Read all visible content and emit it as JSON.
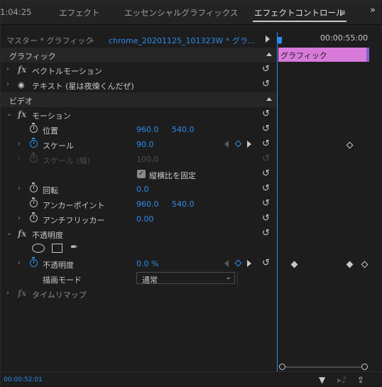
{
  "tabs": {
    "timecode": "1:04:25",
    "effects": "エフェクト",
    "essential_graphics": "エッセンシャルグラフィックス",
    "effect_controls": "エフェクトコントロール",
    "menu_icon": "≡",
    "overflow_icon": "»"
  },
  "header": {
    "master": "マスター * グラフィック",
    "clip": "chrome_20201125_101323W  * グラ..."
  },
  "rows": {
    "graphic_section": "グラフィック",
    "vector_motion": "ベクトルモーション",
    "text_layer": "テキスト (星は夜煉くんだぜ)",
    "video_section": "ビデオ",
    "motion": "モーション",
    "position": "位置",
    "position_x": "960.0",
    "position_y": "540.0",
    "scale": "スケール",
    "scale_value": "90.0",
    "scale_width": "スケール (幅)",
    "scale_width_value": "100.0",
    "uniform_scale": "縦横比を固定",
    "rotation": "回転",
    "rotation_value": "0.0",
    "anchor": "アンカーポイント",
    "anchor_x": "960.0",
    "anchor_y": "540.0",
    "antiflicker": "アンチフリッカー",
    "antiflicker_value": "0.00",
    "opacity_group": "不透明度",
    "opacity": "不透明度",
    "opacity_value": "0.0 %",
    "blend_mode": "描画モード",
    "blend_mode_value": "通常",
    "time_remap": "タイムリマップ"
  },
  "timeline": {
    "timecode": "00:00:55:00",
    "clip_label": "グラフィック"
  },
  "footer": {
    "timecode": "00:00:52:01"
  },
  "colors": {
    "accent": "#2d8ceb",
    "clip": "#d77ad9",
    "background": "#1d1d1d"
  }
}
